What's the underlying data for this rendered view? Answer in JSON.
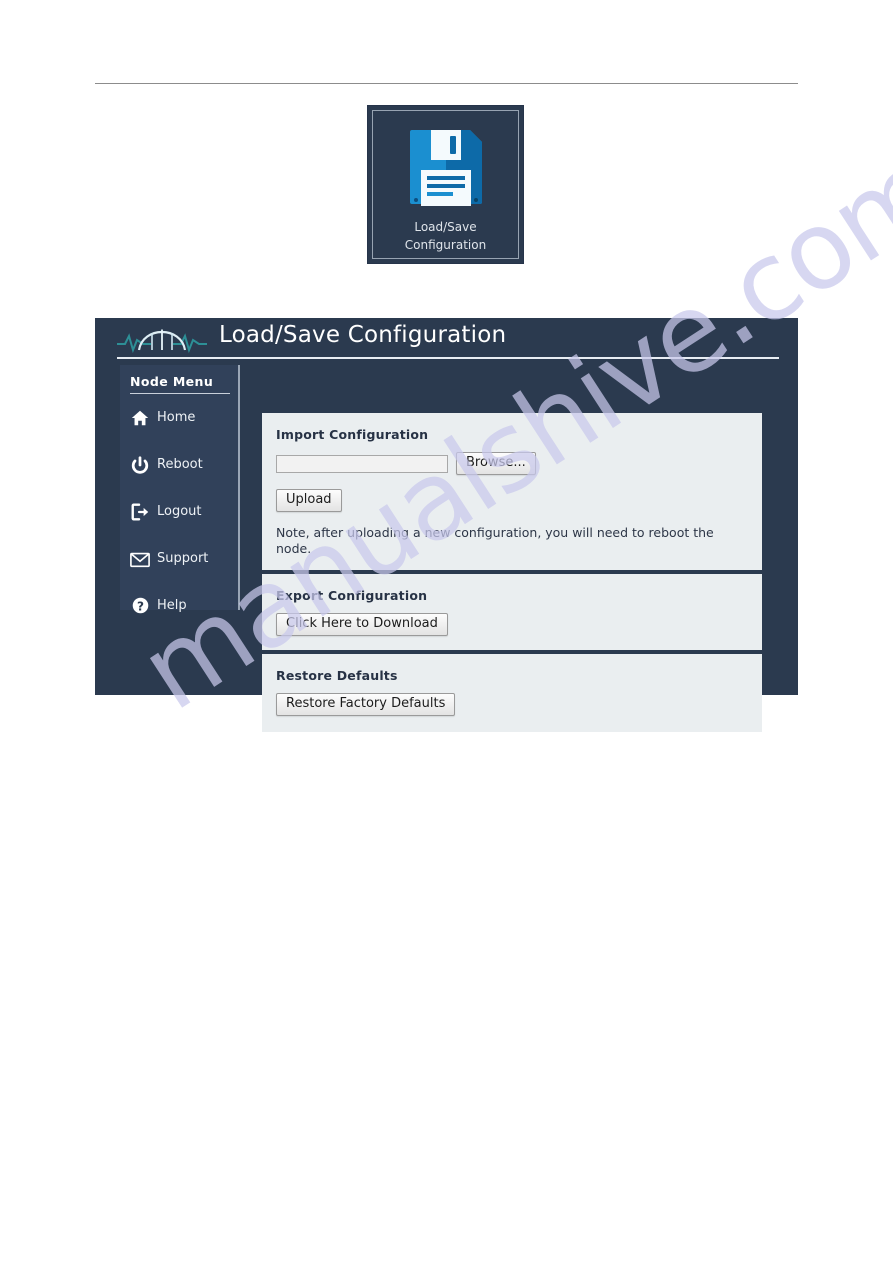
{
  "icon_tile": {
    "icon": "floppy-disk-icon",
    "label_line1": "Load/Save",
    "label_line2": "Configuration",
    "tile_bg": "#2b3a4f",
    "icon_color_light": "#1b8fd0",
    "icon_color_dark": "#0b63a5"
  },
  "app": {
    "logo": "bridge-waveform-logo",
    "title": "Load/Save Configuration",
    "header_bg": "#2b3a4f",
    "panel_bg": "#eaeef0"
  },
  "sidebar": {
    "title": "Node Menu",
    "items": [
      {
        "label": "Home",
        "icon": "home-icon"
      },
      {
        "label": "Reboot",
        "icon": "power-icon"
      },
      {
        "label": "Logout",
        "icon": "logout-arrow-icon"
      },
      {
        "label": "Support",
        "icon": "envelope-icon"
      },
      {
        "label": "Help",
        "icon": "question-circle-icon"
      }
    ]
  },
  "panels": {
    "import": {
      "title": "Import Configuration",
      "file_value": "",
      "file_placeholder": "",
      "browse_label": "Browse...",
      "upload_label": "Upload",
      "note": "Note, after uploading a new configuration, you will need to reboot the node."
    },
    "export": {
      "title": "Export Configuration",
      "download_label": "Click Here to Download"
    },
    "restore": {
      "title": "Restore Defaults",
      "restore_label": "Restore Factory Defaults"
    }
  },
  "watermark": {
    "text": "manualshive.com",
    "color": "#c9c9ec"
  }
}
